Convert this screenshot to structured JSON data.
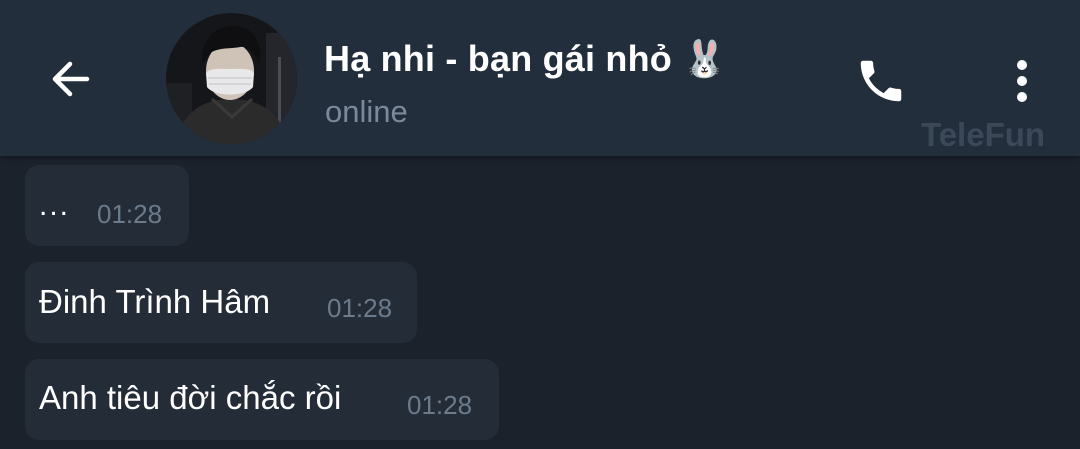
{
  "header": {
    "back_icon": "arrow-left-icon",
    "contact_name": "Hạ nhi - bạn gái nhỏ 🐰",
    "status": "online",
    "call_icon": "phone-icon",
    "menu_icon": "more-vertical-icon",
    "watermark": "TeleFun"
  },
  "messages": [
    {
      "text": "...",
      "time": "01:28"
    },
    {
      "text": "Đinh Trình Hâm",
      "time": "01:28"
    },
    {
      "text": "Anh tiêu đời chắc rồi",
      "time": "01:28"
    }
  ],
  "colors": {
    "header_bg": "#232e3c",
    "chat_bg": "#1c222c",
    "bubble_bg": "#232c37",
    "status_text": "#7a8a9c",
    "time_text": "#6c7b8c"
  }
}
